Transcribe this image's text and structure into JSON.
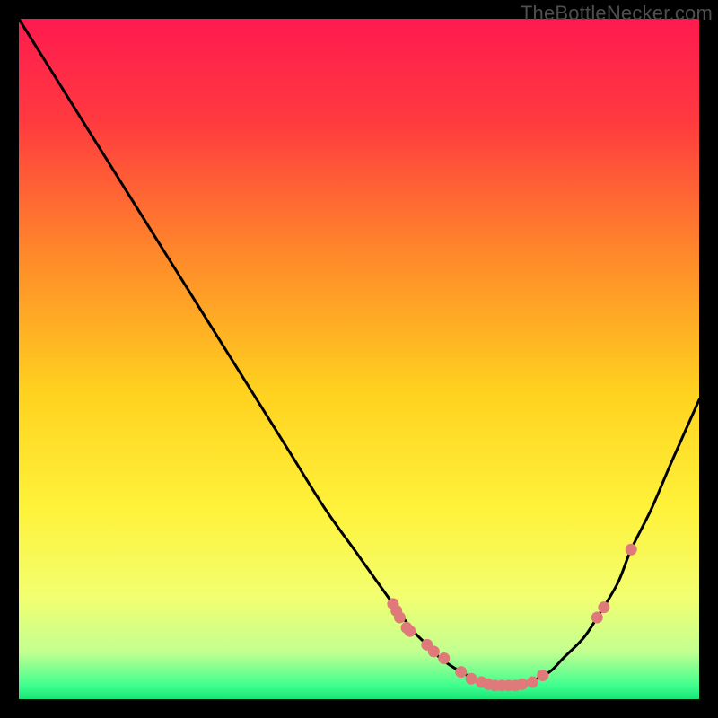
{
  "watermark": "TheBottleNecker.com",
  "chart_data": {
    "type": "line",
    "title": "",
    "xlabel": "",
    "ylabel": "",
    "xlim": [
      0,
      100
    ],
    "ylim": [
      0,
      100
    ],
    "grid": false,
    "series": [
      {
        "name": "curve",
        "x": [
          0,
          5,
          10,
          15,
          20,
          25,
          30,
          35,
          40,
          45,
          50,
          55,
          58,
          60,
          62,
          65,
          68,
          70,
          73,
          75,
          78,
          80,
          83,
          85,
          88,
          90,
          93,
          96,
          100
        ],
        "y": [
          100,
          92,
          84,
          76,
          68,
          60,
          52,
          44,
          36,
          28,
          21,
          14,
          10,
          8,
          6,
          4,
          2.5,
          2,
          2,
          2.5,
          4,
          6,
          9,
          12,
          17,
          22,
          28,
          35,
          44
        ]
      }
    ],
    "scatter_points": {
      "name": "highlight-dots",
      "color": "#e07a7a",
      "x": [
        55,
        55.5,
        56,
        57,
        57.5,
        60,
        61,
        62.5,
        65,
        66.5,
        68,
        69,
        70,
        71,
        72,
        73,
        74,
        75.5,
        77,
        85,
        86,
        90
      ],
      "y": [
        14,
        13,
        12,
        10.5,
        10,
        8,
        7,
        6,
        4,
        3,
        2.5,
        2.2,
        2,
        2,
        2,
        2,
        2.2,
        2.5,
        3.5,
        12,
        13.5,
        22
      ]
    },
    "background_gradient": {
      "type": "vertical",
      "stops": [
        {
          "pos": 0.0,
          "color": "#ff1a4f"
        },
        {
          "pos": 0.15,
          "color": "#ff3a3f"
        },
        {
          "pos": 0.35,
          "color": "#ff8a2a"
        },
        {
          "pos": 0.55,
          "color": "#ffd21f"
        },
        {
          "pos": 0.72,
          "color": "#fff23a"
        },
        {
          "pos": 0.85,
          "color": "#f2ff70"
        },
        {
          "pos": 0.93,
          "color": "#c3ff90"
        },
        {
          "pos": 0.98,
          "color": "#3fff8f"
        },
        {
          "pos": 1.0,
          "color": "#18e676"
        }
      ]
    }
  }
}
